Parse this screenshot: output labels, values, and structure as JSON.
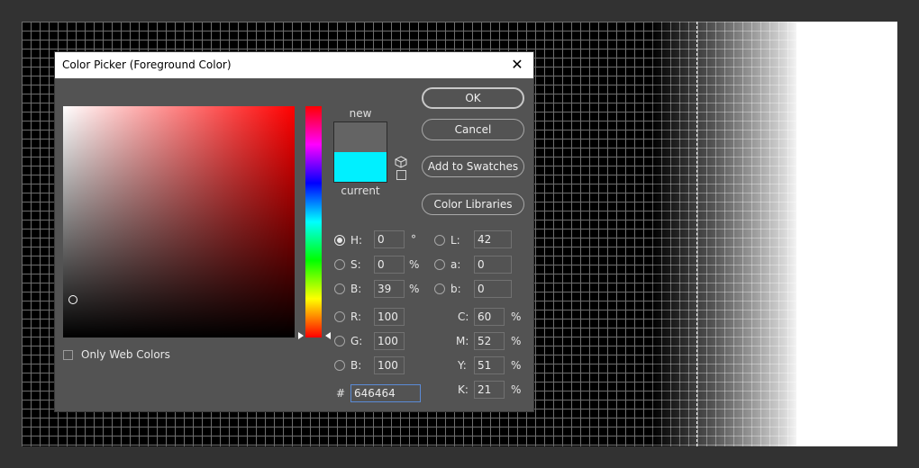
{
  "dialog": {
    "title": "Color Picker (Foreground Color)",
    "close_glyph": "✕"
  },
  "colors": {
    "new_color": "#646464",
    "current_color": "#00f0ff",
    "canvas_grid_bg": "#000000",
    "hue_base": "#ff0000",
    "hex_field_border": "#5b8bd6"
  },
  "swatch": {
    "new_label": "new",
    "current_label": "current"
  },
  "buttons": {
    "ok": "OK",
    "cancel": "Cancel",
    "add_to_swatches": "Add to Swatches",
    "color_libraries": "Color Libraries"
  },
  "web_colors": {
    "label": "Only Web Colors",
    "checked": false
  },
  "hsb": {
    "h": {
      "label": "H:",
      "value": "0",
      "unit": "°",
      "selected": true
    },
    "s": {
      "label": "S:",
      "value": "0",
      "unit": "%",
      "selected": false
    },
    "b": {
      "label": "B:",
      "value": "39",
      "unit": "%",
      "selected": false
    }
  },
  "rgb": {
    "r": {
      "label": "R:",
      "value": "100"
    },
    "g": {
      "label": "G:",
      "value": "100"
    },
    "b": {
      "label": "B:",
      "value": "100"
    }
  },
  "lab": {
    "l": {
      "label": "L:",
      "value": "42"
    },
    "a": {
      "label": "a:",
      "value": "0"
    },
    "b": {
      "label": "b:",
      "value": "0"
    }
  },
  "cmyk": {
    "c": {
      "label": "C:",
      "value": "60",
      "unit": "%"
    },
    "m": {
      "label": "M:",
      "value": "52",
      "unit": "%"
    },
    "y": {
      "label": "Y:",
      "value": "51",
      "unit": "%"
    },
    "k": {
      "label": "K:",
      "value": "21",
      "unit": "%"
    }
  },
  "hex": {
    "hash": "#",
    "value": "646464"
  }
}
